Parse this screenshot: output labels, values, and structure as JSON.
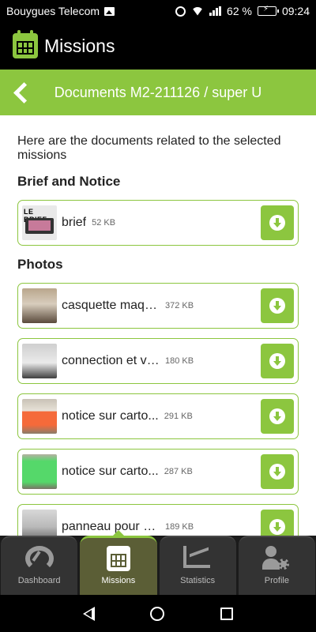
{
  "status_bar": {
    "carrier": "Bouygues Telecom",
    "battery": "62 %",
    "time": "09:24"
  },
  "app_bar": {
    "title": "Missions",
    "icon": "calendar-icon"
  },
  "page_header": {
    "title": "Documents M2-211126 / super U",
    "back_icon": "chevron-left-icon"
  },
  "intro_text": "Here are the documents related to the selected missions",
  "sections": {
    "brief": {
      "title": "Brief and Notice",
      "items": [
        {
          "thumb_text": "LE BRIEF",
          "name": "brief",
          "size": "52 KB"
        }
      ]
    },
    "photos": {
      "title": "Photos",
      "items": [
        {
          "name": "casquette maqu...",
          "size": "372 KB"
        },
        {
          "name": "connection et vi...",
          "size": "180 KB"
        },
        {
          "name": "notice sur carto...",
          "size": "291 KB"
        },
        {
          "name": "notice sur carto...",
          "size": "287 KB"
        },
        {
          "name": "panneau pour vi...",
          "size": "189 KB"
        }
      ]
    }
  },
  "bottom_nav": [
    {
      "label": "Dashboard",
      "icon": "gauge-icon"
    },
    {
      "label": "Missions",
      "icon": "calendar-icon",
      "active": true
    },
    {
      "label": "Statistics",
      "icon": "chart-icon"
    },
    {
      "label": "Profile",
      "icon": "user-gear-icon"
    }
  ],
  "colors": {
    "accent": "#8cc63f",
    "active_tab": "#5b5e36",
    "tab": "#333333"
  }
}
